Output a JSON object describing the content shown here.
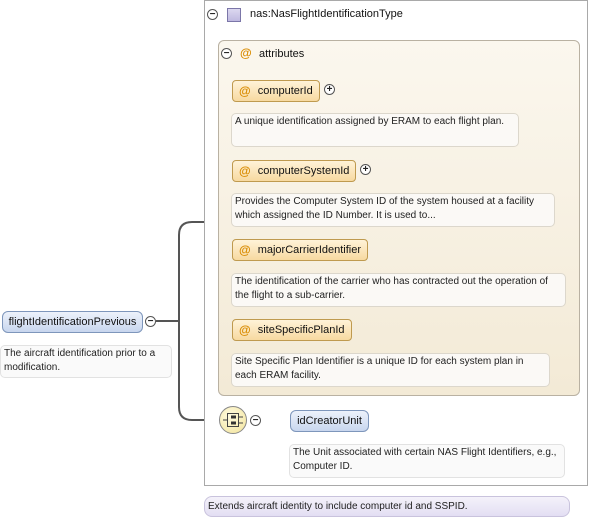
{
  "type_title": "nas:NasFlightIdentificationType",
  "attributes_label": "attributes",
  "attributes": [
    {
      "name": "computerId",
      "expandable": true,
      "description": "A unique identification assigned by ERAM to each flight plan."
    },
    {
      "name": "computerSystemId",
      "expandable": true,
      "description": "Provides the Computer System ID of the system housed at a facility which assigned the ID Number. It is used to..."
    },
    {
      "name": "majorCarrierIdentifier",
      "expandable": false,
      "description": "The identification of the carrier who has contracted out the operation of the flight to a sub-carrier."
    },
    {
      "name": "siteSpecificPlanId",
      "expandable": false,
      "description": "Site Specific Plan Identifier is a unique ID for each system plan in each ERAM facility."
    }
  ],
  "root_element": {
    "name": "flightIdentificationPrevious",
    "description": "The aircraft identification prior to a modification."
  },
  "child_element": {
    "name": "idCreatorUnit",
    "description": "The Unit associated with certain NAS Flight Identifiers, e.g., Computer ID."
  },
  "footer_text": "Extends aircraft identity to include computer id and SSPID.",
  "icons": {
    "collapse": "minus-circle-icon",
    "expand": "plus-circle-icon",
    "attribute": "at-sign-icon",
    "sequence": "sequence-compositor-icon",
    "type": "complex-type-icon"
  },
  "colors": {
    "attribute_chip": "#f7d9a0",
    "element_chip": "#c8d6ee",
    "attr_panel": "#f3ead6",
    "attribute_marker": "#d98b00"
  }
}
